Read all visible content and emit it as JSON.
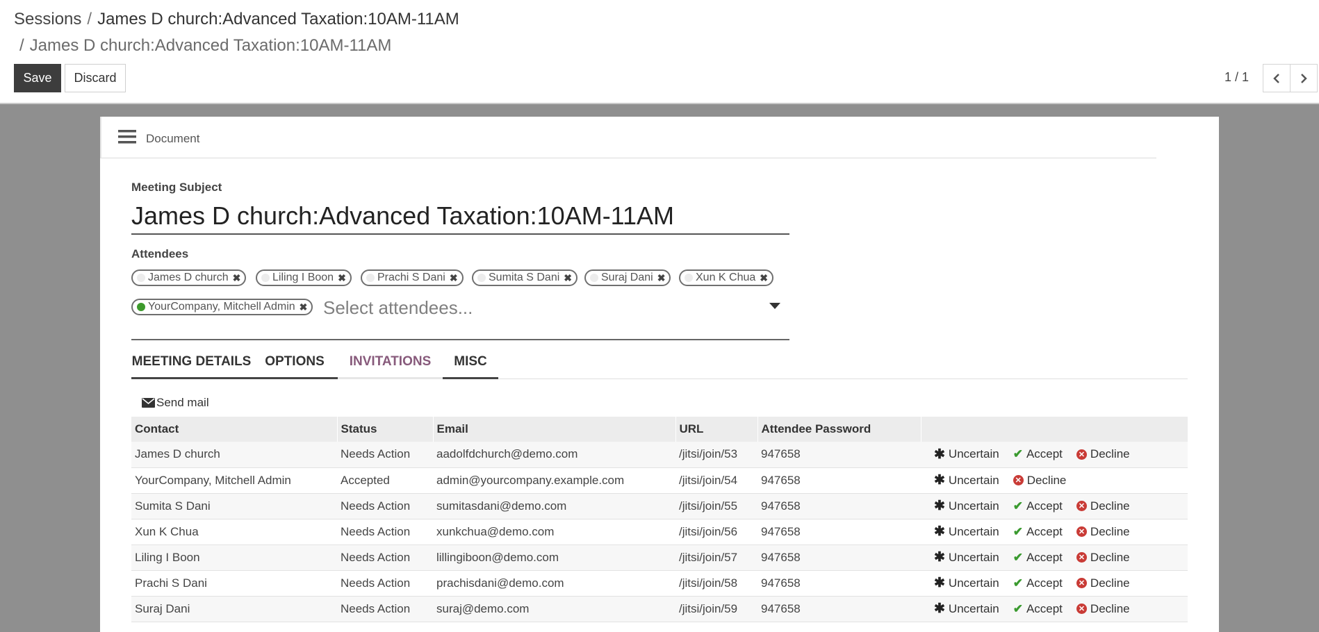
{
  "breadcrumb": {
    "root": "Sessions",
    "separator": "/",
    "current": "James D church:Advanced Taxation:10AM-11AM",
    "sub": "James D church:Advanced Taxation:10AM-11AM"
  },
  "toolbar": {
    "save_label": "Save",
    "discard_label": "Discard"
  },
  "pager": {
    "value": "1 / 1"
  },
  "sheet": {
    "doc_label": "Document",
    "subject_label": "Meeting Subject",
    "subject_value": "James D church:Advanced Taxation:10AM-11AM",
    "attendees_label": "Attendees",
    "attendees_placeholder": "Select attendees...",
    "attendees": [
      {
        "name": "James D church",
        "status_color": "#ececec"
      },
      {
        "name": "Liling I Boon",
        "status_color": "#ececec"
      },
      {
        "name": "Prachi S Dani",
        "status_color": "#ececec"
      },
      {
        "name": "Sumita S Dani",
        "status_color": "#ececec"
      },
      {
        "name": "Suraj Dani",
        "status_color": "#ececec"
      },
      {
        "name": "Xun K Chua",
        "status_color": "#ececec"
      },
      {
        "name": "YourCompany, Mitchell Admin",
        "status_color": "#3d9a2c"
      }
    ]
  },
  "tabs": [
    {
      "label": "MEETING DETAILS",
      "active": false
    },
    {
      "label": "OPTIONS",
      "active": false
    },
    {
      "label": "INVITATIONS",
      "active": true
    },
    {
      "label": "MISC",
      "active": false
    }
  ],
  "invitations": {
    "send_mail_label": "Send mail",
    "columns": [
      "Contact",
      "Status",
      "Email",
      "URL",
      "Attendee Password",
      ""
    ],
    "action_labels": {
      "uncertain": "Uncertain",
      "accept": "Accept",
      "decline": "Decline"
    },
    "rows": [
      {
        "contact": "James D church",
        "status": "Needs Action",
        "email": "aadolfdchurch@demo.com",
        "url": "/jitsi/join/53",
        "password": "947658",
        "show_accept": true
      },
      {
        "contact": "YourCompany, Mitchell Admin",
        "status": "Accepted",
        "email": "admin@yourcompany.example.com",
        "url": "/jitsi/join/54",
        "password": "947658",
        "show_accept": false
      },
      {
        "contact": "Sumita S Dani",
        "status": "Needs Action",
        "email": "sumitasdani@demo.com",
        "url": "/jitsi/join/55",
        "password": "947658",
        "show_accept": true
      },
      {
        "contact": "Xun K Chua",
        "status": "Needs Action",
        "email": "xunkchua@demo.com",
        "url": "/jitsi/join/56",
        "password": "947658",
        "show_accept": true
      },
      {
        "contact": "Liling I Boon",
        "status": "Needs Action",
        "email": "lillingiboon@demo.com",
        "url": "/jitsi/join/57",
        "password": "947658",
        "show_accept": true
      },
      {
        "contact": "Prachi S Dani",
        "status": "Needs Action",
        "email": "prachisdani@demo.com",
        "url": "/jitsi/join/58",
        "password": "947658",
        "show_accept": true
      },
      {
        "contact": "Suraj Dani",
        "status": "Needs Action",
        "email": "suraj@demo.com",
        "url": "/jitsi/join/59",
        "password": "947658",
        "show_accept": true
      }
    ]
  },
  "colors": {
    "accent": "#875a7b",
    "save_button": "#3d3d3d",
    "canvas": "#8f8f8f",
    "accept": "#3a9a2f",
    "decline": "#c93b36"
  }
}
